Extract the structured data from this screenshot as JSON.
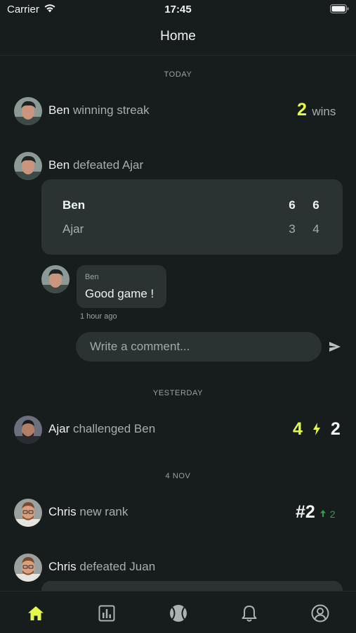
{
  "status_bar": {
    "carrier": "Carrier",
    "time": "17:45"
  },
  "header": {
    "title": "Home"
  },
  "feed": {
    "sections": [
      {
        "label": "TODAY"
      },
      {
        "label": "YESTERDAY"
      },
      {
        "label": "4 NOV"
      }
    ],
    "streak": {
      "name": "Ben",
      "text": " winning streak",
      "count": "2",
      "unit": "wins"
    },
    "match": {
      "name": "Ben",
      "text": " defeated ",
      "opponent": "Ajar",
      "winner": {
        "name": "Ben",
        "sets": [
          "6",
          "6"
        ]
      },
      "loser": {
        "name": "Ajar",
        "sets": [
          "3",
          "4"
        ]
      }
    },
    "comment": {
      "author": "Ben",
      "text": "Good game !",
      "time": "1 hour ago"
    },
    "comment_input": {
      "placeholder": "Write a comment..."
    },
    "challenge": {
      "name": "Ajar",
      "text": " challenged Ben",
      "left": "4",
      "right": "2"
    },
    "rank": {
      "name": "Chris",
      "text": " new rank",
      "rank": "#2",
      "delta": "2"
    },
    "match2": {
      "name": "Chris",
      "text": " defeated Juan"
    }
  },
  "colors": {
    "accent": "#e4f74f",
    "rank_up": "#2ea043",
    "background": "#171d1c",
    "card": "#2b3332"
  },
  "tab_bar": {
    "items": [
      {
        "icon": "home-icon",
        "active": true
      },
      {
        "icon": "stats-icon",
        "active": false
      },
      {
        "icon": "tennis-ball-icon",
        "active": false
      },
      {
        "icon": "bell-icon",
        "active": false
      },
      {
        "icon": "profile-icon",
        "active": false
      }
    ]
  }
}
